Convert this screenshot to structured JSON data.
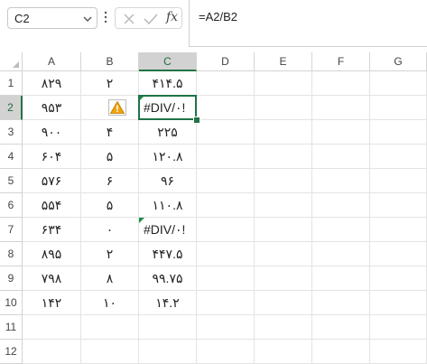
{
  "formula_bar": {
    "name_box": "C2",
    "formula": "=A2/B2",
    "fx_label": "fx"
  },
  "columns": [
    "A",
    "B",
    "C",
    "D",
    "E",
    "F",
    "G"
  ],
  "rows": [
    {
      "num": "1",
      "a": "۸۲۹",
      "b": "۲",
      "c": "۴۱۴.۵"
    },
    {
      "num": "2",
      "a": "۹۵۳",
      "b": "",
      "c": "#DIV/۰!"
    },
    {
      "num": "3",
      "a": "۹۰۰",
      "b": "۴",
      "c": "۲۲۵"
    },
    {
      "num": "4",
      "a": "۶۰۴",
      "b": "۵",
      "c": "۱۲۰.۸"
    },
    {
      "num": "5",
      "a": "۵۷۶",
      "b": "۶",
      "c": "۹۶"
    },
    {
      "num": "6",
      "a": "۵۵۴",
      "b": "۵",
      "c": "۱۱۰.۸"
    },
    {
      "num": "7",
      "a": "۶۳۴",
      "b": "۰",
      "c": "#DIV/۰!"
    },
    {
      "num": "8",
      "a": "۸۹۵",
      "b": "۲",
      "c": "۴۴۷.۵"
    },
    {
      "num": "9",
      "a": "۷۹۸",
      "b": "۸",
      "c": "۹۹.۷۵"
    },
    {
      "num": "10",
      "a": "۱۴۲",
      "b": "۱۰",
      "c": "۱۴.۲"
    },
    {
      "num": "11",
      "a": "",
      "b": "",
      "c": ""
    },
    {
      "num": "12",
      "a": "",
      "b": "",
      "c": ""
    }
  ],
  "selection": {
    "column": "C",
    "row": "2"
  },
  "colors": {
    "accent": "#217346",
    "error_marker": "#1e8c45",
    "warning": "#f0a30a"
  }
}
